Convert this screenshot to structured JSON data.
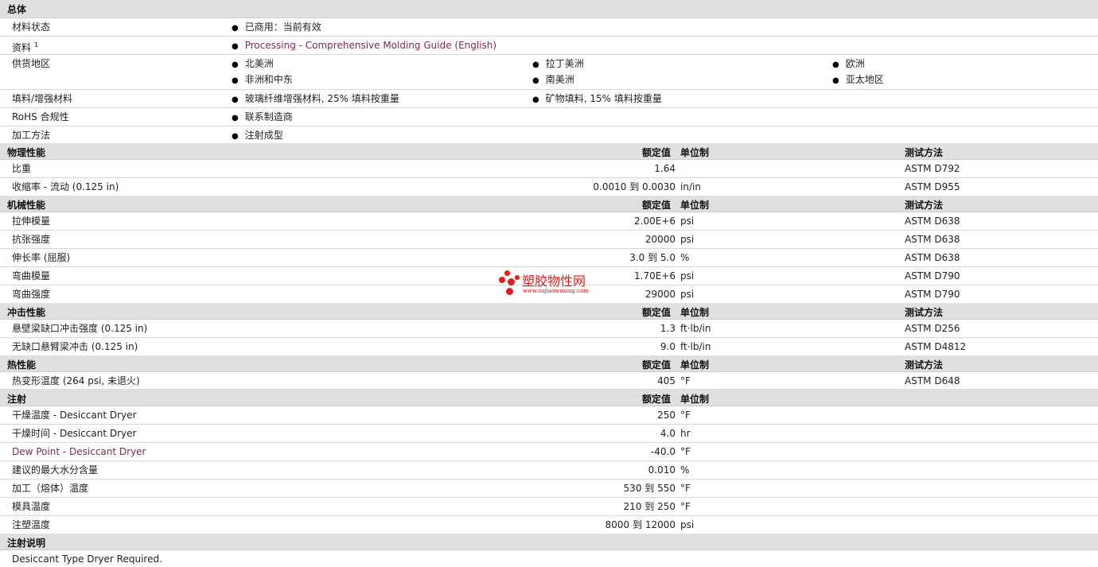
{
  "sections": {
    "general": "总体",
    "physical": "物理性能",
    "mechanical": "机械性能",
    "impact": "冲击性能",
    "thermal": "热性能",
    "injection": "注射",
    "injection_notes": "注射说明"
  },
  "headers": {
    "nominal": "额定值",
    "unit": "单位制",
    "test": "测试方法"
  },
  "general": {
    "status_label": "材料状态",
    "status_value": "已商用：当前有效",
    "docs_label": "资料",
    "docs_sup": "1",
    "docs_value": "Processing - Comprehensive Molding Guide (English)",
    "region_label": "供货地区",
    "regions": [
      "北美洲",
      "拉丁美洲",
      "欧洲",
      "非洲和中东",
      "南美洲",
      "亚太地区"
    ],
    "filler_label": "填料/增强材料",
    "fillers": [
      "玻璃纤维增强材料, 25% 填料按重量",
      "矿物填料, 15% 填料按重量"
    ],
    "rohs_label": "RoHS 合规性",
    "rohs_value": "联系制造商",
    "process_label": "加工方法",
    "process_value": "注射成型"
  },
  "physical": [
    {
      "label": "比重",
      "value": "1.64",
      "unit": "",
      "test": "ASTM D792"
    },
    {
      "label": "收缩率  - 流动  (0.125 in)",
      "value": "0.0010 到  0.0030",
      "unit": "in/in",
      "test": "ASTM D955"
    }
  ],
  "mechanical": [
    {
      "label": "拉伸模量",
      "value": "2.00E+6",
      "unit": "psi",
      "test": "ASTM D638"
    },
    {
      "label": "抗张强度",
      "value": "20000",
      "unit": "psi",
      "test": "ASTM D638"
    },
    {
      "label": "伸长率  (屈服)",
      "value": "3.0 到  5.0",
      "unit": "%",
      "test": "ASTM D638"
    },
    {
      "label": "弯曲模量",
      "value": "1.70E+6",
      "unit": "psi",
      "test": "ASTM D790"
    },
    {
      "label": "弯曲强度",
      "value": "29000",
      "unit": "psi",
      "test": "ASTM D790"
    }
  ],
  "impact": [
    {
      "label": "悬壁梁缺口冲击强度  (0.125 in)",
      "value": "1.3",
      "unit": "ft·lb/in",
      "test": "ASTM D256"
    },
    {
      "label": "无缺口悬臂梁冲击  (0.125 in)",
      "value": "9.0",
      "unit": "ft·lb/in",
      "test": "ASTM D4812"
    }
  ],
  "thermal": [
    {
      "label": "热变形温度  (264 psi, 未退火)",
      "value": "405",
      "unit": "°F",
      "test": "ASTM D648"
    }
  ],
  "injection": [
    {
      "label": "干燥温度  - Desiccant Dryer",
      "value": "250",
      "unit": "°F",
      "link": false
    },
    {
      "label": "干燥时间  - Desiccant Dryer",
      "value": "4.0",
      "unit": "hr",
      "link": false
    },
    {
      "label": "Dew Point - Desiccant Dryer",
      "value": "-40.0",
      "unit": "°F",
      "link": true
    },
    {
      "label": "建议的最大水分含量",
      "value": "0.010",
      "unit": "%",
      "link": false
    },
    {
      "label": "加工（熔体）温度",
      "value": "530 到  550",
      "unit": "°F",
      "link": false
    },
    {
      "label": "模具温度",
      "value": "210 到  250",
      "unit": "°F",
      "link": false
    },
    {
      "label": "注塑温度",
      "value": "8000 到  12000",
      "unit": "psi",
      "link": false
    }
  ],
  "notes": "Desiccant Type Dryer Required.",
  "watermark": {
    "title": "塑胶物性网",
    "url": "www.sujiaowuxing.com"
  }
}
